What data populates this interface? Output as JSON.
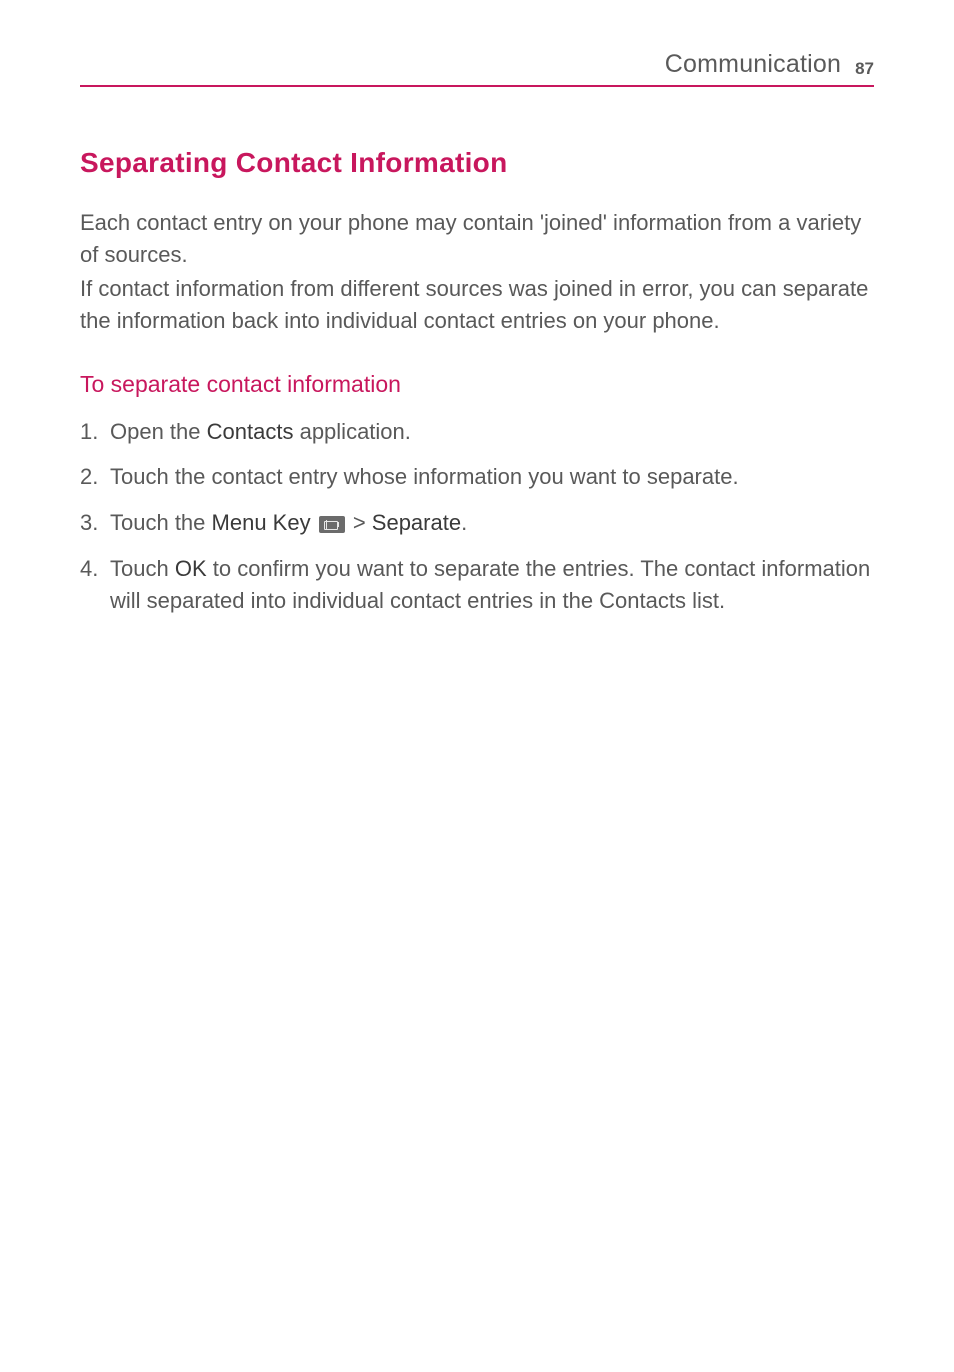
{
  "header": {
    "title": "Communication",
    "page_number": "87"
  },
  "section": {
    "heading": "Separating Contact Information",
    "intro1": "Each contact entry on your phone may contain 'joined' information from a variety of sources.",
    "intro2": "If contact information from different sources was joined in error, you can separate the information back into individual contact entries on your phone.",
    "subheading": "To separate contact information",
    "steps": {
      "s1": {
        "num": "1.",
        "pre": "Open the ",
        "bold1": "Contacts",
        "post": " application."
      },
      "s2": {
        "num": "2.",
        "text": "Touch the contact entry whose information you want to separate."
      },
      "s3": {
        "num": "3.",
        "pre": "Touch the ",
        "bold1": "Menu Key",
        "gt": " > ",
        "bold2": "Separate",
        "post": "."
      },
      "s4": {
        "num": "4.",
        "pre": "Touch ",
        "bold1": "OK",
        "post": " to confirm you want to separate the entries. The contact information will separated into individual contact entries in the Contacts list."
      }
    }
  }
}
